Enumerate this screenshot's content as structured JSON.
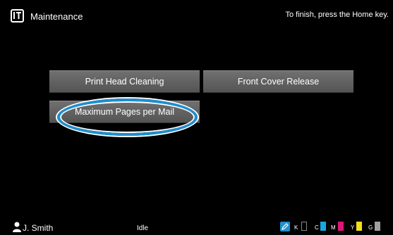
{
  "header": {
    "title": "Maintenance",
    "hint": "To finish, press the Home key."
  },
  "buttons": {
    "print_head_cleaning": "Print Head Cleaning",
    "front_cover_release": "Front Cover Release",
    "maximum_pages_per_mail": "Maximum Pages per Mail"
  },
  "footer": {
    "user": "J. Smith",
    "status": "Idle",
    "inks": [
      {
        "label": "K",
        "color": "#111111",
        "level": 1.0
      },
      {
        "label": "C",
        "color": "#18a8e0",
        "level": 1.0
      },
      {
        "label": "M",
        "color": "#e0147a",
        "level": 1.0
      },
      {
        "label": "Y",
        "color": "#f2e01a",
        "level": 1.0
      },
      {
        "label": "G",
        "color": "#a0a0a0",
        "level": 1.0
      }
    ]
  },
  "colors": {
    "accent": "#1e8fd0",
    "button": "#666666",
    "background": "#000000"
  },
  "icons": [
    "maintenance-icon",
    "user-icon",
    "edit-icon"
  ]
}
